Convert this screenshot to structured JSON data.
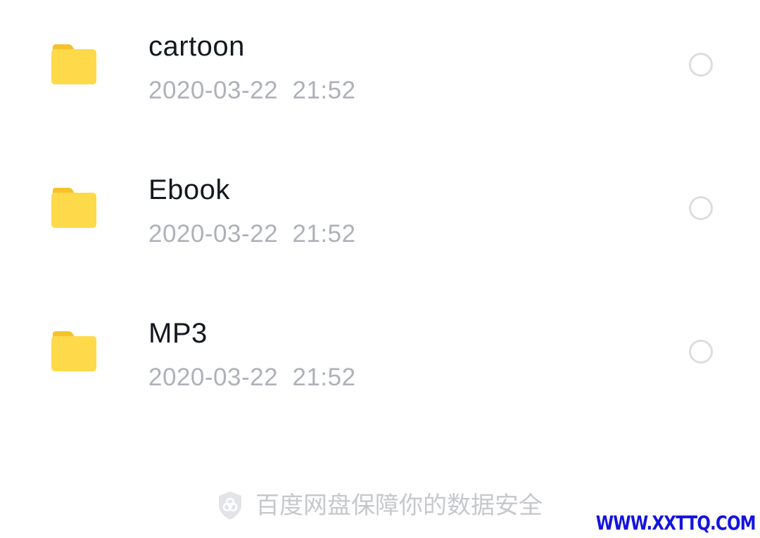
{
  "files": [
    {
      "name": "cartoon",
      "date": "2020-03-22  21:52",
      "icon": "folder-icon"
    },
    {
      "name": "Ebook",
      "date": "2020-03-22  21:52",
      "icon": "folder-icon"
    },
    {
      "name": "MP3",
      "date": "2020-03-22  21:52",
      "icon": "folder-icon"
    }
  ],
  "footer": {
    "text": "百度网盘保障你的数据安全",
    "icon": "shield-icon"
  },
  "watermark": {
    "text": "WWW.XXTTQ.COM"
  },
  "colors": {
    "folder_body": "#fed94a",
    "folder_tab": "#f5c22b",
    "name_text": "#14181f",
    "date_text": "#aeb1b8",
    "radio_border": "#dcdde0",
    "footer_text": "#c6c8cc",
    "watermark_text": "#1414e0"
  }
}
